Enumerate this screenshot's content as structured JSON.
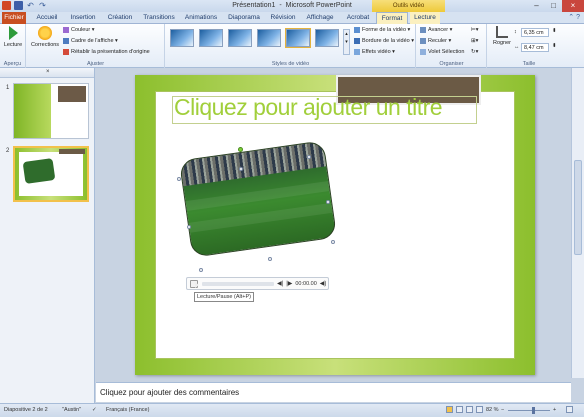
{
  "window": {
    "doc_title": "Présentation1",
    "separator": "-",
    "app_name": "Microsoft PowerPoint",
    "context_tab": "Outils vidéo"
  },
  "tabs": [
    {
      "label": "Fichier"
    },
    {
      "label": "Accueil"
    },
    {
      "label": "Insertion"
    },
    {
      "label": "Création"
    },
    {
      "label": "Transitions"
    },
    {
      "label": "Animations"
    },
    {
      "label": "Diaporama"
    },
    {
      "label": "Révision"
    },
    {
      "label": "Affichage"
    },
    {
      "label": "Acrobat"
    },
    {
      "label": "Format"
    },
    {
      "label": "Lecture"
    }
  ],
  "ribbon": {
    "apercu": {
      "play_label": "Lecture",
      "group_label": "Aperçu"
    },
    "ajuster": {
      "corrections_label": "Corrections",
      "couleur": "Couleur",
      "cadre": "Cadre de l'affiche",
      "retablir": "Rétablir la présentation d'origine",
      "group_label": "Ajuster"
    },
    "styles": {
      "forme": "Forme de la vidéo",
      "bordure": "Bordure de la vidéo",
      "effets": "Effets vidéo",
      "group_label": "Styles de vidéo"
    },
    "organiser": {
      "avancer": "Avancer",
      "reculer": "Reculer",
      "volet": "Volet Sélection",
      "group_label": "Organiser"
    },
    "taille": {
      "rogner": "Rogner",
      "height": "6,35 cm",
      "width": "8,47 cm",
      "group_label": "Taille"
    }
  },
  "slides_panel": {
    "close": "×",
    "slide1_num": "1",
    "slide2_num": "2"
  },
  "slide": {
    "title_placeholder": "Cliquez pour ajouter un titre"
  },
  "video_controls": {
    "time": "00:00.00",
    "tooltip": "Lecture/Pause (Alt+P)"
  },
  "notes": {
    "placeholder": "Cliquez pour ajouter des commentaires"
  },
  "status": {
    "slide_info": "Diapositive 2 de 2",
    "theme": "\"Austin\"",
    "language": "Français (France)",
    "zoom": "82 %",
    "zoom_minus": "−",
    "zoom_plus": "+"
  },
  "colors": {
    "accent_green": "#a1cf3b",
    "file_tab": "#c84e20",
    "brown_bar": "#6b5a45"
  }
}
